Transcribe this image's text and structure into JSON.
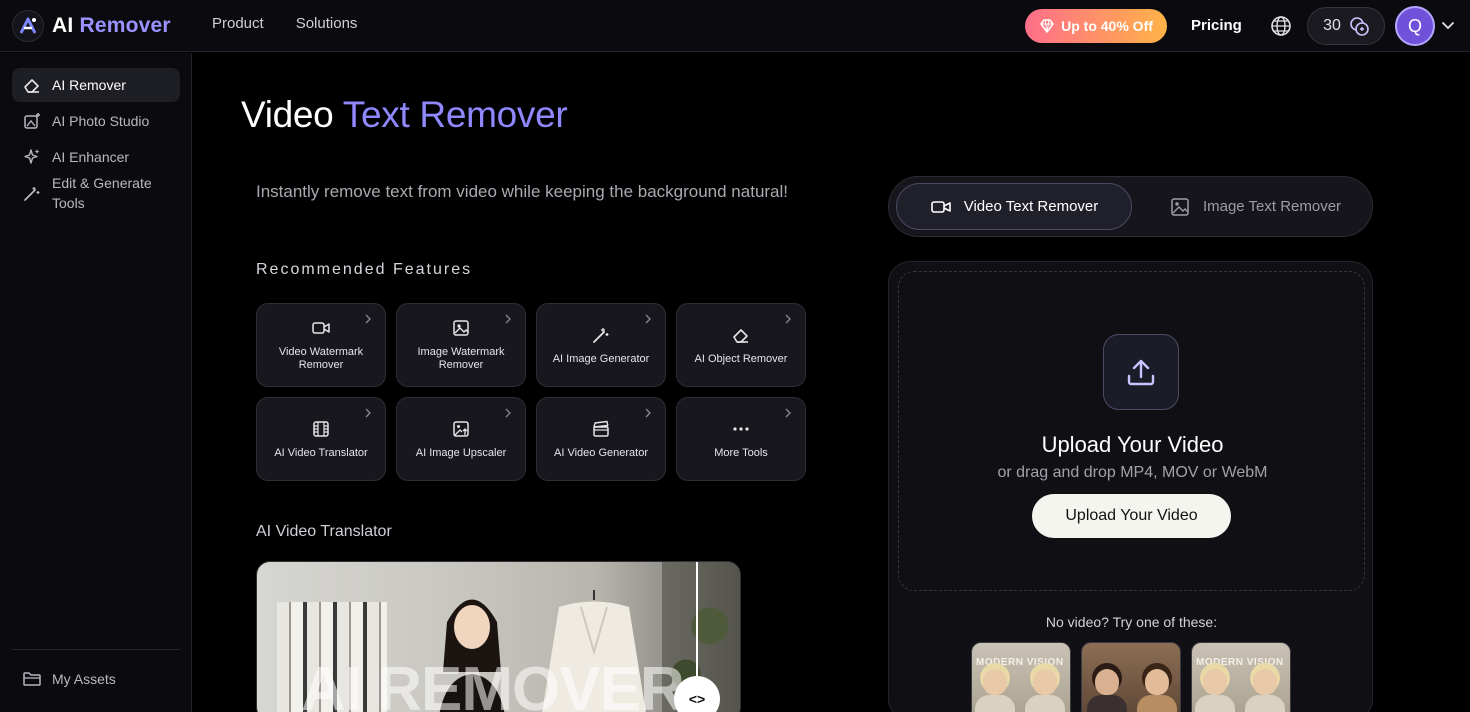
{
  "header": {
    "logo_prefix": "AI",
    "logo_accent": "Remover",
    "nav": [
      "Product",
      "Solutions"
    ],
    "promo": "Up to 40% Off",
    "pricing": "Pricing",
    "credits": "30",
    "avatar_initial": "Q"
  },
  "sidebar": {
    "items": [
      {
        "label": "AI Remover",
        "icon": "eraser-icon"
      },
      {
        "label": "AI Photo Studio",
        "icon": "photo-sparkle-icon"
      },
      {
        "label": "AI Enhancer",
        "icon": "sparkles-icon"
      },
      {
        "label": "Edit & Generate Tools",
        "icon": "magic-wand-icon"
      }
    ],
    "assets": "My Assets"
  },
  "main": {
    "title_plain": "Video ",
    "title_accent": "Text Remover",
    "subtitle": "Instantly remove text from video while keeping the background natural!",
    "recommended_title": "Recommended Features",
    "features": [
      {
        "label": "Video Watermark Remover",
        "icon": "video-camera-icon"
      },
      {
        "label": "Image Watermark Remover",
        "icon": "image-icon"
      },
      {
        "label": "AI Image Generator",
        "icon": "magic-wand-icon"
      },
      {
        "label": "AI Object Remover",
        "icon": "eraser-icon"
      },
      {
        "label": "AI Video Translator",
        "icon": "film-icon"
      },
      {
        "label": "AI Image Upscaler",
        "icon": "image-upscale-icon"
      },
      {
        "label": "AI Video Generator",
        "icon": "clapperboard-icon"
      },
      {
        "label": "More Tools",
        "icon": "more-dots-icon"
      }
    ],
    "preview_title": "AI Video Translator",
    "preview_watermark": "AI REMOVER",
    "compare_glyph": "<>"
  },
  "panel": {
    "tabs": [
      {
        "label": "Video Text Remover",
        "active": true
      },
      {
        "label": "Image Text Remover",
        "active": false
      }
    ],
    "upload_title": "Upload Your Video",
    "upload_sub": "or drag and drop MP4, MOV or WebM",
    "upload_button": "Upload Your Video",
    "try_label": "No video? Try one of these:",
    "sample_texts": [
      "MODERN VISION",
      "",
      "MODERN VISION"
    ]
  },
  "colors": {
    "accent": "#8f88ff",
    "background": "#000000",
    "promo_start": "#ff6e8a",
    "promo_end": "#ffb347",
    "avatar": "#6f52d9"
  }
}
